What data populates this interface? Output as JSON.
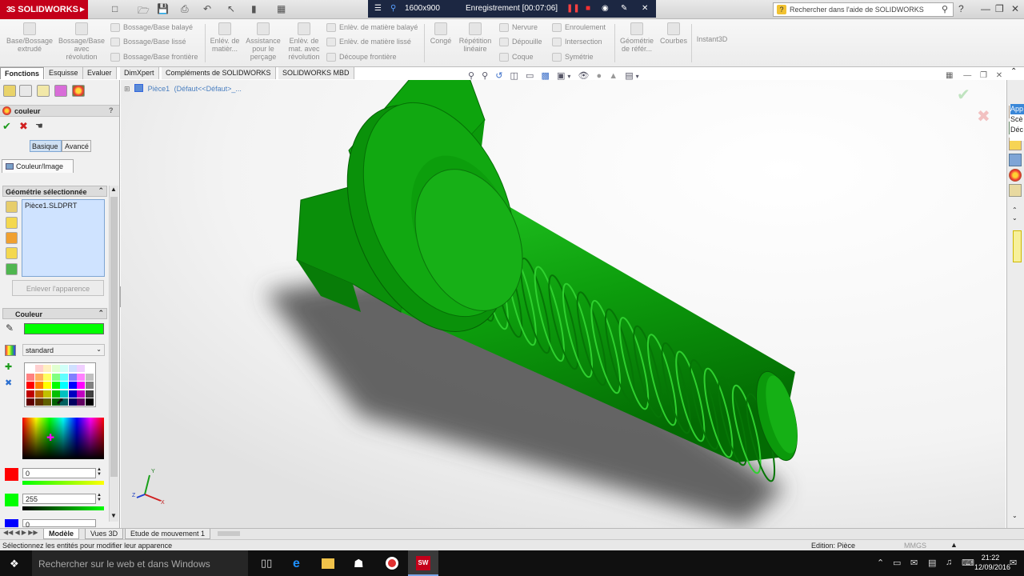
{
  "app": {
    "logo_text": "SOLIDWORKS",
    "logo_prefix": "3S"
  },
  "recording": {
    "resolution": "1600x900",
    "status": "Enregistrement [00:07:06]"
  },
  "help_search": {
    "placeholder": "Rechercher dans l'aide de SOLIDWORKS"
  },
  "ribbon": {
    "items": [
      {
        "label": "Base/Bossage extrudé"
      },
      {
        "label": "Bossage/Base avec révolution"
      },
      {
        "label": "Enlév. de matièr..."
      },
      {
        "label": "Assistance pour le perçage"
      },
      {
        "label": "Enlèv. de mat. avec révolution"
      },
      {
        "label": "Congé"
      },
      {
        "label": "Répétition linéaire"
      },
      {
        "label": "Géométrie de référ..."
      },
      {
        "label": "Courbes"
      },
      {
        "label": "Instant3D"
      }
    ],
    "small_items": [
      {
        "label": "Bossage/Base balayé"
      },
      {
        "label": "Bossage/Base lissé"
      },
      {
        "label": "Bossage/Base frontière"
      },
      {
        "label": "Enlèv. de matière balayé"
      },
      {
        "label": "Enlèv. de matière lissé"
      },
      {
        "label": "Découpe frontière"
      },
      {
        "label": "Nervure"
      },
      {
        "label": "Dépouille"
      },
      {
        "label": "Coque"
      },
      {
        "label": "Enroulement"
      },
      {
        "label": "Intersection"
      },
      {
        "label": "Symétrie"
      }
    ]
  },
  "tabs": [
    {
      "label": "Fonctions",
      "active": true
    },
    {
      "label": "Esquisse"
    },
    {
      "label": "Evaluer"
    },
    {
      "label": "DimXpert"
    },
    {
      "label": "Compléments de SOLIDWORKS"
    },
    {
      "label": "SOLIDWORKS MBD"
    }
  ],
  "property_manager": {
    "title": "couleur",
    "help": "?",
    "mode_basic": "Basique",
    "mode_advanced": "Avancé",
    "tab_label": "Couleur/Image",
    "selected_geometry_header": "Géométrie sélectionnée",
    "selected_item": "Pièce1.SLDPRT",
    "remove_appearance_button": "Enlever l'apparence",
    "color_header": "Couleur",
    "current_color": "#00ff00",
    "palette_select": "standard",
    "red_value": "0",
    "green_value": "255",
    "blue_value": "0"
  },
  "feature_tree": {
    "part_label": "Pièce1",
    "config_label": "(Défaut<<Défaut>_..."
  },
  "colors": {
    "part_green": "#0aa00a",
    "accent_red": "#c4001a",
    "selection_blue": "#cfe3ff"
  },
  "bottom_tabs": [
    {
      "label": "Modèle",
      "active": true
    },
    {
      "label": "Vues 3D"
    },
    {
      "label": "Etude de mouvement 1"
    }
  ],
  "status": {
    "hint": "Sélectionnez les entités pour modifier leur apparence",
    "mode": "Edition: Pièce",
    "units": "MMGS"
  },
  "taskpane_labels": {
    "app": "App",
    "scene": "Scè",
    "dec": "Déc"
  },
  "taskbar": {
    "search": "Rechercher sur le web et dans Windows",
    "time": "21:22",
    "date": "12/09/2016"
  }
}
